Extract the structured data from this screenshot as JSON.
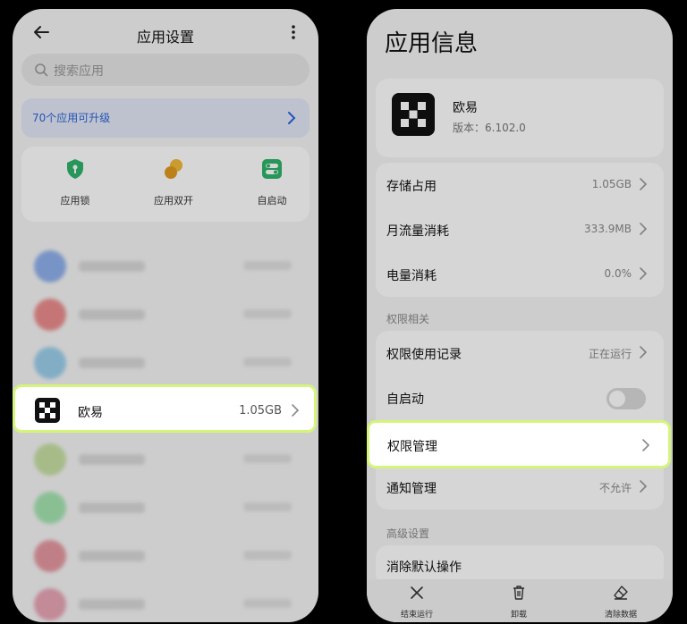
{
  "left_screen": {
    "title": "应用设置",
    "search_placeholder": "搜索应用",
    "upgrade_banner": "70个应用可升级",
    "quick_actions": [
      {
        "label": "应用锁",
        "icon": "shield-lock-icon",
        "color": "#2fb36b"
      },
      {
        "label": "应用双开",
        "icon": "dual-circles-icon",
        "color": "#e8a72a"
      },
      {
        "label": "自启动",
        "icon": "toggle-switch-icon",
        "color": "#2fb36b"
      }
    ],
    "highlighted_app": {
      "name": "欧易",
      "size": "1.05GB"
    }
  },
  "right_screen": {
    "title": "应用信息",
    "app": {
      "name": "欧易",
      "version": "版本：6.102.0"
    },
    "usage_rows": [
      {
        "label": "存储占用",
        "value": "1.05GB"
      },
      {
        "label": "月流量消耗",
        "value": "333.9MB"
      },
      {
        "label": "电量消耗",
        "value": "0.0%"
      }
    ],
    "permissions_section": "权限相关",
    "permission_rows": [
      {
        "label": "权限使用记录",
        "value": "正在运行"
      },
      {
        "label": "自启动",
        "value": ""
      }
    ],
    "highlighted_row": "权限管理",
    "notification_row": {
      "label": "通知管理",
      "value": "不允许"
    },
    "advanced_section": "高级设置",
    "advanced_row": "消除默认操作",
    "bottom_actions": [
      {
        "label": "结束运行",
        "icon": "close-x-icon"
      },
      {
        "label": "卸载",
        "icon": "trash-icon"
      },
      {
        "label": "清除数据",
        "icon": "eraser-icon"
      }
    ]
  },
  "colors": {
    "highlight_border": "#d5f57a",
    "accent_blue": "#2b63d9"
  }
}
